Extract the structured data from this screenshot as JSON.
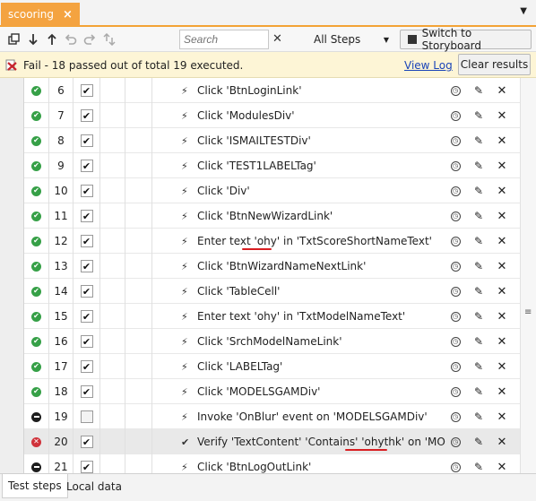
{
  "tabs": [
    {
      "label": "scooring"
    }
  ],
  "toolbar": {
    "search_placeholder": "Search",
    "steps_filter": "All Steps",
    "switch_label": "Switch to Storyboard"
  },
  "status": {
    "message": "Fail - 18 passed out of total 19 executed.",
    "view_log": "View Log",
    "clear_results": "Clear results"
  },
  "steps": [
    {
      "num": "6",
      "status": "pass",
      "enabled": true,
      "action_icon": "bolt-icon",
      "text": "Click 'BtnLoginLink'"
    },
    {
      "num": "7",
      "status": "pass",
      "enabled": true,
      "action_icon": "bolt-icon",
      "text": "Click 'ModulesDiv'"
    },
    {
      "num": "8",
      "status": "pass",
      "enabled": true,
      "action_icon": "bolt-icon",
      "text": "Click 'ISMAILTESTDiv'"
    },
    {
      "num": "9",
      "status": "pass",
      "enabled": true,
      "action_icon": "bolt-icon",
      "text": "Click 'TEST1LABELTag'"
    },
    {
      "num": "10",
      "status": "pass",
      "enabled": true,
      "action_icon": "bolt-icon",
      "text": "Click 'Div'"
    },
    {
      "num": "11",
      "status": "pass",
      "enabled": true,
      "action_icon": "bolt-icon",
      "text": "Click 'BtnNewWizardLink'"
    },
    {
      "num": "12",
      "status": "pass",
      "enabled": true,
      "action_icon": "bolt-icon",
      "text": "Enter text 'ohy' in 'TxtScoreShortNameText'"
    },
    {
      "num": "13",
      "status": "pass",
      "enabled": true,
      "action_icon": "bolt-icon",
      "text": "Click 'BtnWizardNameNextLink'"
    },
    {
      "num": "14",
      "status": "pass",
      "enabled": true,
      "action_icon": "bolt-icon",
      "text": "Click 'TableCell'"
    },
    {
      "num": "15",
      "status": "pass",
      "enabled": true,
      "action_icon": "bolt-icon",
      "text": "Enter text 'ohy' in 'TxtModelNameText'"
    },
    {
      "num": "16",
      "status": "pass",
      "enabled": true,
      "action_icon": "bolt-icon",
      "text": "Click 'SrchModelNameLink'"
    },
    {
      "num": "17",
      "status": "pass",
      "enabled": true,
      "action_icon": "bolt-icon",
      "text": "Click 'LABELTag'"
    },
    {
      "num": "18",
      "status": "pass",
      "enabled": true,
      "action_icon": "bolt-icon",
      "text": "Click 'MODELSGAMDiv'"
    },
    {
      "num": "19",
      "status": "skip",
      "enabled": false,
      "action_icon": "bolt-icon",
      "text": "Invoke 'OnBlur' event on 'MODELSGAMDiv'"
    },
    {
      "num": "20",
      "status": "fail",
      "enabled": true,
      "action_icon": "checkmark-icon",
      "text": "Verify 'TextContent' 'Contains' 'ohythk' on 'MODELS"
    },
    {
      "num": "21",
      "status": "skip",
      "enabled": true,
      "action_icon": "bolt-icon",
      "text": "Click 'BtnLogOutLink'"
    }
  ],
  "bottom_tabs": [
    {
      "label": "Test steps"
    },
    {
      "label": "Local data"
    }
  ]
}
